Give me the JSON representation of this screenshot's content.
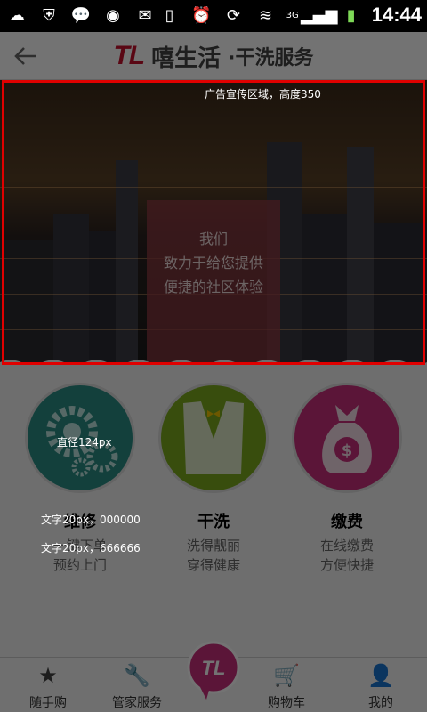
{
  "status_bar": {
    "time": "14:44",
    "network": "3G",
    "left_icons": [
      "cloud-icon",
      "shield-icon",
      "chat-icon",
      "bird-icon",
      "mail-icon"
    ],
    "right_icons": [
      "phone-icon",
      "alarm-icon",
      "rotate-icon",
      "wifi-icon",
      "signal-icon",
      "battery-icon"
    ]
  },
  "header": {
    "back_icon": "arrow-left-icon",
    "logo": "TL",
    "brand_name": "嘻生活",
    "service": "·干洗服务"
  },
  "banner": {
    "annotation": "广告宣传区域，高度350",
    "card_lines": [
      "我们",
      "致力于给您提供",
      "便捷的社区体验"
    ]
  },
  "services": [
    {
      "name": "维修",
      "line1": "一键下单",
      "line2": "预约上门",
      "color": "#2a8f86",
      "icon": "gears-icon"
    },
    {
      "name": "干洗",
      "line1": "洗得靓丽",
      "line2": "穿得健康",
      "color": "#7cac1e",
      "icon": "suit-icon"
    },
    {
      "name": "缴费",
      "line1": "在线缴费",
      "line2": "方便快捷",
      "color": "#c92f7d",
      "icon": "money-bag-icon"
    }
  ],
  "annotations": {
    "diameter": "直径124px",
    "title_font": "文字20px，000000",
    "sub_font": "文字20px，666666"
  },
  "bottom_nav": {
    "items": [
      {
        "label": "随手购",
        "icon": "star-icon"
      },
      {
        "label": "管家服务",
        "icon": "wrench-icon"
      },
      {
        "label": "购物车",
        "icon": "cart-icon"
      },
      {
        "label": "我的",
        "icon": "person-icon"
      }
    ],
    "center_logo": "TL"
  }
}
